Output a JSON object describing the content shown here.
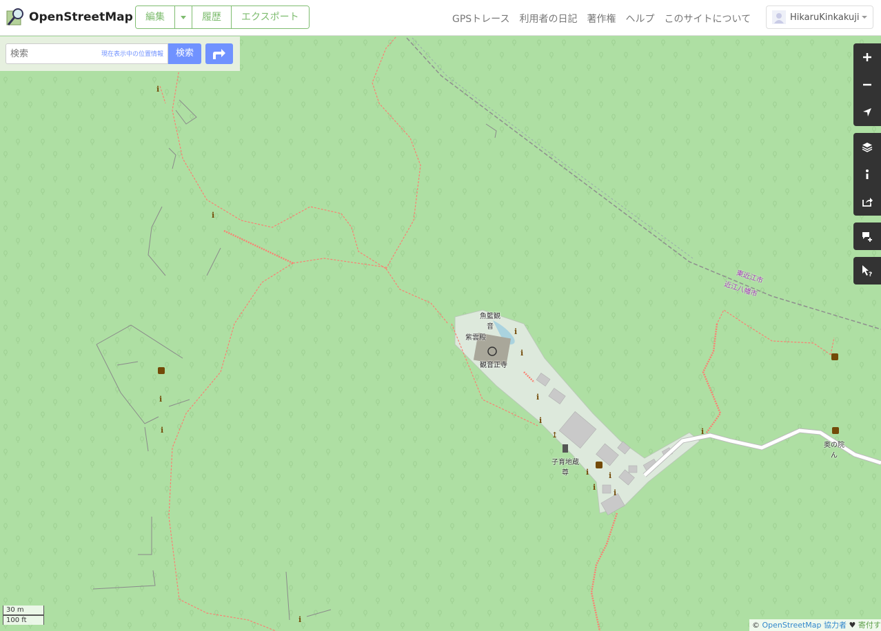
{
  "header": {
    "site_title": "OpenStreetMap",
    "edit_label": "編集",
    "history_label": "履歴",
    "export_label": "エクスポート",
    "nav": [
      "GPSトレース",
      "利用者の日記",
      "著作権",
      "ヘルプ",
      "このサイトについて"
    ],
    "user_name": "HikaruKinkakuji"
  },
  "search": {
    "placeholder": "検索",
    "where_am_i": "現在表示中の位置情報",
    "button_label": "検索"
  },
  "map": {
    "labels": {
      "gyoran_kannon_1": "魚籃観",
      "gyoran_kannon_2": "音",
      "shiunden": "紫雲殿",
      "temple": "観音正寺",
      "jizo_1": "子育地蔵",
      "jizo_2": "尊",
      "okunoin_1": "奥の院",
      "okunoin_2": "ん",
      "rail_1": "東近江市",
      "rail_2": "近江八幡市"
    },
    "colors": {
      "forest": "#aedfa3",
      "landuse": "#dde9dc",
      "building": "#c9c9c9",
      "temple_building": "#a9a79a",
      "path": "#fa8072",
      "road": "#ffffff",
      "boundary": "#8e8e8e"
    }
  },
  "controls": {
    "zoom_in": "zoom-in-icon",
    "zoom_out": "zoom-out-icon",
    "locate": "locate-icon",
    "layers": "layers-icon",
    "info": "info-icon",
    "share": "share-icon",
    "note": "add-note-icon",
    "query": "query-icon"
  },
  "scale": {
    "metric": "30 m",
    "imperial": "100 ft"
  },
  "attribution": {
    "copyright": "©",
    "osm": "OpenStreetMap",
    "contributors": "協力者",
    "heart": "♥",
    "donate": "寄付する"
  }
}
